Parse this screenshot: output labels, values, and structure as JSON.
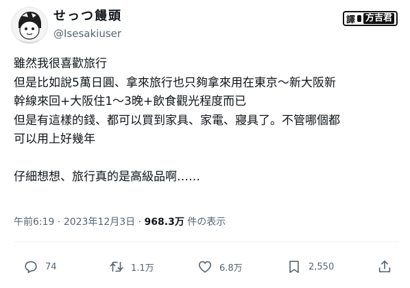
{
  "user": {
    "display_name": "せっつ饅頭",
    "handle": "@Isesakiuser",
    "avatar_icon": "avatar-illustration-icon"
  },
  "watermark": {
    "prefix": "譯",
    "name": "方吉君"
  },
  "tweet": {
    "text": "雖然我很喜歡旅行\n但是比如說5萬日圓、拿來旅行也只夠拿來用在東京〜新大阪新\n幹線來回+大阪住1〜3晚+飲食觀光程度而已\n但是有這樣的錢、都可以買到家具、家電、寢具了。不管哪個都\n可以用上好幾年\n\n仔細想想、旅行真的是高級品啊……"
  },
  "meta": {
    "time": "午前6:19",
    "separator": "·",
    "date": "2023年12月3日",
    "separator2": "·",
    "views_count": "968.3万",
    "views_label": "件の表示"
  },
  "actions": {
    "reply": {
      "icon": "reply-icon",
      "count": "74"
    },
    "retweet": {
      "icon": "retweet-icon",
      "count": "1.1万"
    },
    "like": {
      "icon": "like-icon",
      "count": "6.8万"
    },
    "bookmark": {
      "icon": "bookmark-icon",
      "count": "2,550"
    },
    "share": {
      "icon": "share-icon"
    }
  },
  "colors": {
    "text": "#0f1419",
    "secondary": "#536471",
    "divider": "#eff3f4"
  }
}
